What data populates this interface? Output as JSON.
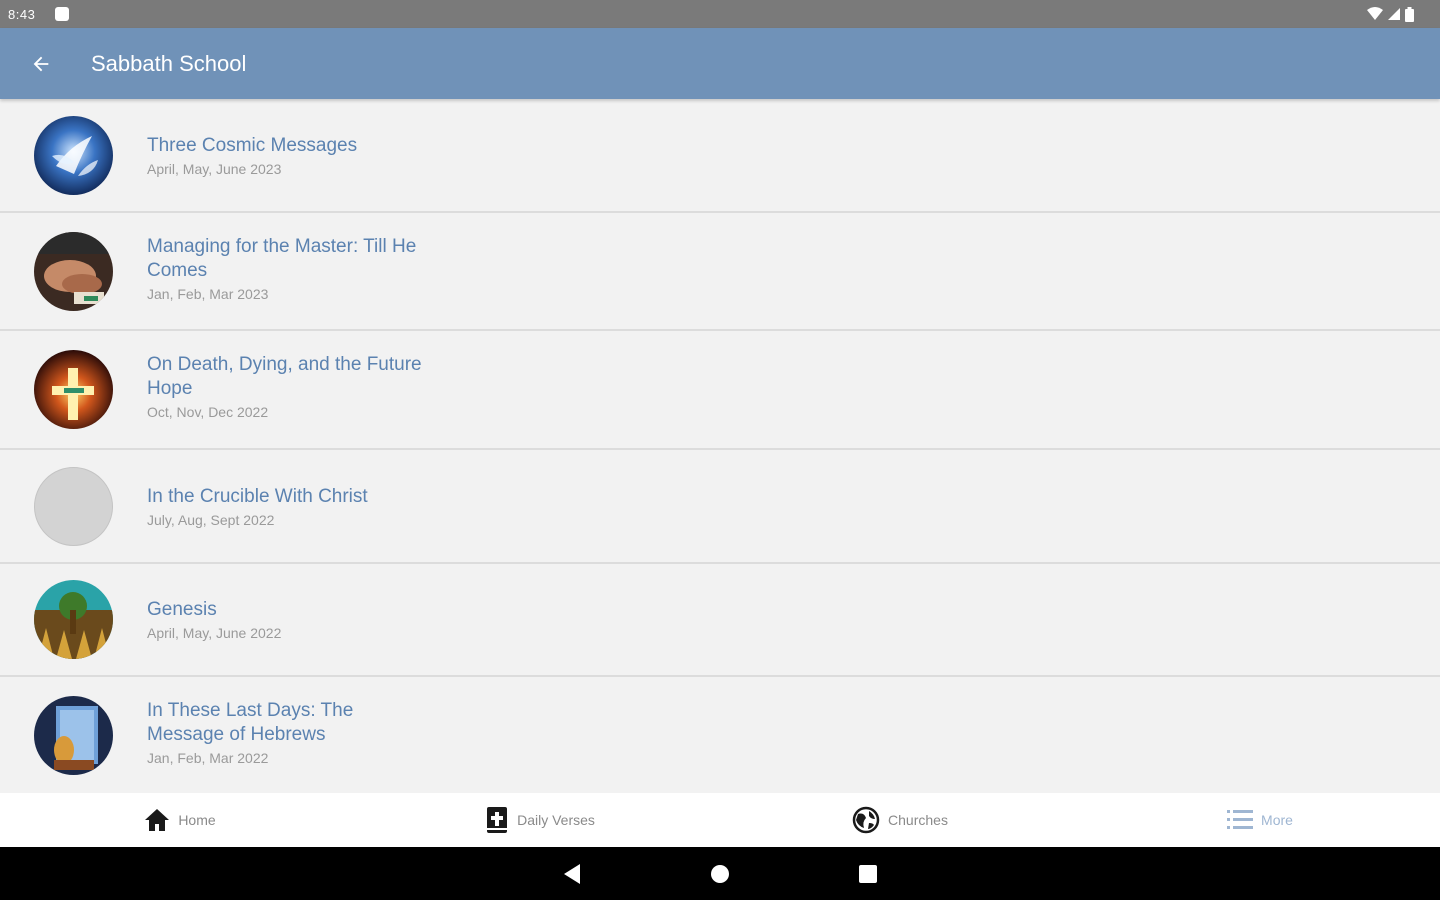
{
  "status_bar": {
    "time": "8:43",
    "icons": [
      "notification-dot-icon",
      "wifi-icon",
      "signal-icon",
      "battery-icon"
    ]
  },
  "app_bar": {
    "title": "Sabbath School",
    "back_icon": "arrow-left-icon",
    "color": "#7092b8"
  },
  "lessons": [
    {
      "title": "Three Cosmic Messages",
      "subtitle": "April, May, June 2023",
      "thumb": "angels-cover"
    },
    {
      "title": "Managing for the Master: Till He Comes",
      "subtitle": "Jan, Feb, Mar 2023",
      "thumb": "hands-cover"
    },
    {
      "title": "On Death, Dying, and the Future Hope",
      "subtitle": "Oct, Nov, Dec 2022",
      "thumb": "cross-cover"
    },
    {
      "title": "In the Crucible With Christ",
      "subtitle": "July, Aug, Sept 2022",
      "thumb": "blank-placeholder"
    },
    {
      "title": "Genesis",
      "subtitle": "April, May, June 2022",
      "thumb": "genesis-cover"
    },
    {
      "title": "In These Last Days: The Message of Hebrews",
      "subtitle": "Jan, Feb, Mar 2022",
      "thumb": "hebrews-cover"
    }
  ],
  "bottom_nav": {
    "items": [
      {
        "label": "Home",
        "icon": "home-icon"
      },
      {
        "label": "Daily Verses",
        "icon": "bible-icon"
      },
      {
        "label": "Churches",
        "icon": "globe-icon"
      },
      {
        "label": "More",
        "icon": "menu-list-icon",
        "active": true
      }
    ]
  },
  "system_nav": {
    "buttons": [
      "back-triangle-icon",
      "home-circle-icon",
      "recents-square-icon"
    ]
  },
  "colors": {
    "accent": "#5b82b0",
    "app_bar": "#7092b8",
    "subtitle": "#9a9a9a",
    "divider": "#dcdcdc"
  }
}
